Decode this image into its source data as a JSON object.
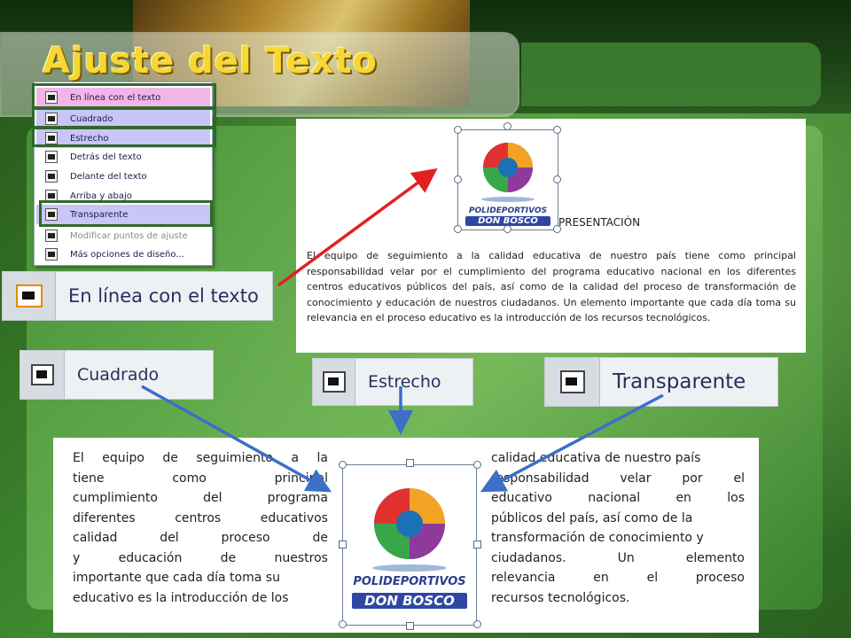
{
  "slide": {
    "title": "Ajuste del Texto"
  },
  "menu": {
    "items": [
      {
        "label": "En línea con el texto",
        "highlight": "pink"
      },
      {
        "label": "Cuadrado",
        "highlight": "blue"
      },
      {
        "label": "Estrecho",
        "highlight": "blue"
      },
      {
        "label": "Detrás del texto",
        "highlight": "none"
      },
      {
        "label": "Delante del texto",
        "highlight": "none"
      },
      {
        "label": "Arriba y abajo",
        "highlight": "none"
      },
      {
        "label": "Transparente",
        "highlight": "blue"
      },
      {
        "label": "Modificar puntos de ajuste",
        "highlight": "none",
        "disabled": true
      },
      {
        "label": "Más opciones de diseño...",
        "highlight": "none"
      }
    ]
  },
  "callouts": {
    "inline": "En línea con el texto",
    "square": "Cuadrado",
    "tight": "Estrecho",
    "through": "Transparente"
  },
  "logo": {
    "line1": "POLIDEPORTIVOS",
    "line2": "DON BOSCO"
  },
  "doc": {
    "heading": "PRESENTACIÓN",
    "paragraph": "El equipo de seguimiento a la calidad educativa de nuestro país tiene como principal responsabilidad velar por el cumplimiento del programa educativo nacional en los diferentes centros educativos públicos del país, así como de la calidad del proceso de transformación de conocimiento y educación de nuestros ciudadanos. Un elemento importante que cada día toma su relevancia en el proceso educativo es la introducción de los recursos tecnológicos."
  },
  "wrap_example": {
    "left_lines": [
      [
        "El",
        "equipo",
        "de",
        "seguimiento",
        "a",
        "la"
      ],
      [
        "tiene",
        "como",
        "principal"
      ],
      [
        "cumplimiento",
        "del",
        "programa"
      ],
      [
        "diferentes",
        "centros",
        "educativos"
      ],
      [
        "calidad",
        "del",
        "proceso",
        "de"
      ],
      [
        "y",
        "educación",
        "de",
        "nuestros"
      ],
      [
        "importante que cada día toma su"
      ],
      [
        "educativo es la introducción de los"
      ]
    ],
    "right_lines": [
      [
        "calidad educativa de nuestro país"
      ],
      [
        "responsabilidad",
        "velar",
        "por",
        "el"
      ],
      [
        "educativo",
        "nacional",
        "en",
        "los"
      ],
      [
        "públicos del país, así como de la"
      ],
      [
        "transformación de conocimiento y"
      ],
      [
        "ciudadanos.",
        "Un",
        "elemento"
      ],
      [
        "relevancia",
        "en",
        "el",
        "proceso"
      ],
      [
        "recursos tecnológicos."
      ]
    ]
  },
  "colors": {
    "title": "#f6d733",
    "red_arrow": "#e32020",
    "blue_arrow": "#3b6fc8",
    "highlight_box": "#2d6a2a"
  }
}
